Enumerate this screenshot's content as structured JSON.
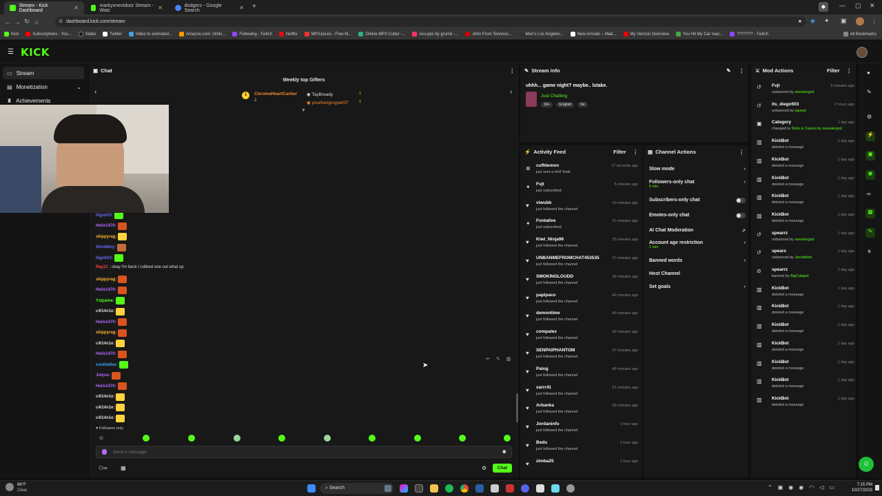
{
  "browser": {
    "tabs": [
      {
        "title": "Stream - Kick Dashboard",
        "active": true
      },
      {
        "title": "markyxnextdoor Stream - Watc"
      },
      {
        "title": "dodgers - Google Search"
      }
    ],
    "url": "dashboard.kick.com/stream",
    "bookmarks": [
      "Kick",
      "Subscriptions - You...",
      "Stake",
      "Twitter",
      "Video to animated...",
      "Amazon.com: Onlin...",
      "Following - Twitch",
      "Netflix",
      "MP3Juices - Free M...",
      "Online MP3 Cutter -...",
      "osu-pps by grumd -...",
      "John From Tenness...",
      "Men's Los Angeles...",
      "New Arrivals – Mad...",
      "My Verizon Overview",
      "You Hit My Car reac...",
      "??????? - Twitch"
    ],
    "all_bookmarks": "All Bookmarks"
  },
  "app": {
    "logo": "KICK",
    "accent": "#53fc18",
    "nav": [
      {
        "label": "Stream",
        "active": true
      },
      {
        "label": "Monetization"
      },
      {
        "label": "Achievements"
      }
    ]
  },
  "chat": {
    "title": "Chat",
    "gifters_title": "Weekly top Gifters",
    "gifters": [
      {
        "rank": "1",
        "name": "ChromeHeartCartier",
        "count": "2"
      },
      {
        "rank": "",
        "name": "TayBready",
        "count": "1"
      },
      {
        "rank": "",
        "name": "yourfrengroyper07",
        "count": "1"
      }
    ],
    "messages": [
      {
        "user": "iligxdV3:",
        "color": "#6c6cff"
      },
      {
        "user": "Helix1470:",
        "color": "#b36bff"
      },
      {
        "user": "skippyrag:",
        "color": "#ffb22e"
      },
      {
        "user": "Skrubbzy:",
        "color": "#6c6cff"
      },
      {
        "user": "iligxdV3:",
        "color": "#6c6cff"
      },
      {
        "user": "Ray21",
        "color": "#ff4444",
        "text": ": okay I'm back I rubbed one out what up"
      },
      {
        "user": "skippyrag:",
        "color": "#ffb22e"
      },
      {
        "user": "Helix1470:",
        "color": "#b36bff"
      },
      {
        "user": "Yslpaine:",
        "color": "#53fc18"
      },
      {
        "user": "c4l14n1e:",
        "color": "#ddd"
      },
      {
        "user": "Helix1470:",
        "color": "#b36bff"
      },
      {
        "user": "skippyrag:",
        "color": "#ffb22e"
      },
      {
        "user": "c4l14n1e:",
        "color": "#ddd"
      },
      {
        "user": "Helix1470:",
        "color": "#b36bff"
      },
      {
        "user": "cooltodisc:",
        "color": "#3da9ff"
      },
      {
        "user": "Julyus:",
        "color": "#b36bff"
      },
      {
        "user": "Helix1470:",
        "color": "#b36bff"
      },
      {
        "user": "c4l14n1e:",
        "color": "#ddd"
      },
      {
        "user": "c4l14n1e:",
        "color": "#ddd"
      },
      {
        "user": "c4l14n1e:",
        "color": "#ddd"
      }
    ],
    "followers_only": "Followers only",
    "placeholder": "Send a message",
    "send_label": "Chat"
  },
  "stream_info": {
    "header": "Stream info",
    "title": "uhhh... game night? maybe.. lstake.",
    "category": "Just Chatting",
    "tags": [
      "18+",
      "English",
      "fut"
    ]
  },
  "activity": {
    "header": "Activity Feed",
    "filter": "Filter",
    "items": [
      {
        "name": "cuffdemon",
        "desc": "just sent a Hell Yeah",
        "time": "27 seconds ago",
        "icon": "gift"
      },
      {
        "name": "Fvjt",
        "desc": "just subscribed",
        "time": "5 minutes ago",
        "icon": "star"
      },
      {
        "name": "viwubb",
        "desc": "just followed the channel",
        "time": "10 minutes ago",
        "icon": "heart"
      },
      {
        "name": "Fontalive",
        "desc": "just subscribed",
        "time": "21 minutes ago",
        "icon": "star"
      },
      {
        "name": "Kiwi_Ninja96",
        "desc": "just followed the channel",
        "time": "25 minutes ago",
        "icon": "heart"
      },
      {
        "name": "UNBANMEFROMCHAT453535",
        "desc": "just followed the channel",
        "time": "27 minutes ago",
        "icon": "heart"
      },
      {
        "name": "SMOKINGLOUDD",
        "desc": "just followed the channel",
        "time": "35 minutes ago",
        "icon": "heart"
      },
      {
        "name": "papipaco",
        "desc": "just followed the channel",
        "time": "40 minutes ago",
        "icon": "heart"
      },
      {
        "name": "demontime",
        "desc": "just followed the channel",
        "time": "40 minutes ago",
        "icon": "heart"
      },
      {
        "name": "compalex",
        "desc": "just followed the channel",
        "time": "42 minutes ago",
        "icon": "heart"
      },
      {
        "name": "SENPAIPHANTOM",
        "desc": "just followed the channel",
        "time": "47 minutes ago",
        "icon": "heart"
      },
      {
        "name": "Palog",
        "desc": "just followed the channel",
        "time": "49 minutes ago",
        "icon": "heart"
      },
      {
        "name": "xarrr41",
        "desc": "just followed the channel",
        "time": "51 minutes ago",
        "icon": "heart"
      },
      {
        "name": "Arbanka",
        "desc": "just followed the channel",
        "time": "59 minutes ago",
        "icon": "heart"
      },
      {
        "name": "Jordaninfo",
        "desc": "just followed the channel",
        "time": "1 hour ago",
        "icon": "heart"
      },
      {
        "name": "Bedu",
        "desc": "just followed the channel",
        "time": "1 hour ago",
        "icon": "heart"
      },
      {
        "name": "zimba25",
        "desc": "",
        "time": "1 hour ago",
        "icon": "heart"
      }
    ]
  },
  "channel_actions": {
    "header": "Channel Actions",
    "items": [
      {
        "label": "Slow mode",
        "type": "chev"
      },
      {
        "label": "Followers-only chat",
        "sub": "6 min",
        "type": "chev"
      },
      {
        "label": "Subscribers-only chat",
        "type": "toggle"
      },
      {
        "label": "Emotes-only chat",
        "type": "toggle"
      },
      {
        "label": "AI Chat Moderation",
        "type": "ext"
      },
      {
        "label": "Account age restriction",
        "sub": "1 min",
        "type": "chev"
      },
      {
        "label": "Banned words",
        "type": "chev"
      },
      {
        "label": "Host Channel",
        "type": "none"
      },
      {
        "label": "Set goals",
        "type": "chev"
      }
    ]
  },
  "mod_actions": {
    "header": "Mod Actions",
    "filter": "Filter",
    "items": [
      {
        "name": "Fvjt",
        "desc": "unbanned by",
        "by": "sweatergxd",
        "time": "5 minutes ago",
        "icon": "undo"
      },
      {
        "name": "its_diego503",
        "desc": "unbanned by",
        "by": "squeal",
        "time": "2 hours ago",
        "icon": "undo"
      },
      {
        "name": "Category",
        "desc": "changed to",
        "by": "Slots & Casino by sweatergxd",
        "time": "1 day ago",
        "icon": "cat"
      },
      {
        "name": "KickBot",
        "desc": "deleted a message",
        "by": "",
        "time": "1 day ago",
        "icon": "trash"
      },
      {
        "name": "KickBot",
        "desc": "deleted a message",
        "by": "",
        "time": "1 day ago",
        "icon": "trash"
      },
      {
        "name": "KickBot",
        "desc": "deleted a message",
        "by": "",
        "time": "1 day ago",
        "icon": "trash"
      },
      {
        "name": "KickBot",
        "desc": "deleted a message",
        "by": "",
        "time": "1 day ago",
        "icon": "trash"
      },
      {
        "name": "KickBot",
        "desc": "deleted a message",
        "by": "",
        "time": "1 day ago",
        "icon": "trash"
      },
      {
        "name": "spearrz",
        "desc": "unbanned by",
        "by": "sweatergxd",
        "time": "1 day ago",
        "icon": "undo"
      },
      {
        "name": "spears",
        "desc": "unbanned by",
        "by": "Jacobbhtx",
        "time": "1 day ago",
        "icon": "undo"
      },
      {
        "name": "spearrz",
        "desc": "banned by",
        "by": "BigCaligxd",
        "time": "1 day ago",
        "icon": "ban"
      },
      {
        "name": "KickBot",
        "desc": "deleted a message",
        "by": "",
        "time": "1 day ago",
        "icon": "trash"
      },
      {
        "name": "KickBot",
        "desc": "deleted a message",
        "by": "",
        "time": "1 day ago",
        "icon": "trash"
      },
      {
        "name": "KickBot",
        "desc": "deleted a message",
        "by": "",
        "time": "1 day ago",
        "icon": "trash"
      },
      {
        "name": "KickBot",
        "desc": "deleted a message",
        "by": "",
        "time": "1 day ago",
        "icon": "trash"
      },
      {
        "name": "KickBot",
        "desc": "deleted a message",
        "by": "",
        "time": "1 day ago",
        "icon": "trash"
      },
      {
        "name": "KickBot",
        "desc": "deleted a message",
        "by": "",
        "time": "1 day ago",
        "icon": "trash"
      },
      {
        "name": "KickBot",
        "desc": "deleted a message",
        "by": "",
        "time": "1 day ago",
        "icon": "trash"
      }
    ]
  },
  "taskbar": {
    "weather_temp": "66°F",
    "weather_desc": "Clear",
    "search": "Search",
    "time": "7:15 PM",
    "date": "10/27/2023"
  }
}
